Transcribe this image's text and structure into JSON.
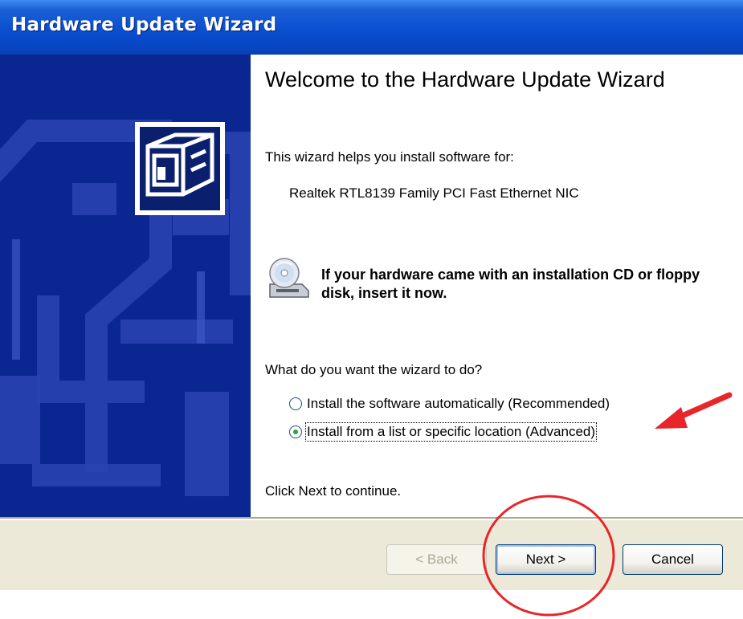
{
  "window": {
    "title": "Hardware Update Wizard"
  },
  "content": {
    "heading": "Welcome to the Hardware Update Wizard",
    "intro": "This wizard helps you install software for:",
    "device_name": "Realtek RTL8139 Family PCI Fast Ethernet NIC",
    "cd_prompt": "If your hardware came with an installation CD or floppy disk, insert it now.",
    "question": "What do you want the wizard to do?",
    "options": [
      {
        "label": "Install the software automatically (Recommended)",
        "selected": false
      },
      {
        "label": "Install from a list or specific location (Advanced)",
        "selected": true
      }
    ],
    "continue_hint": "Click Next to continue."
  },
  "buttons": {
    "back": "< Back",
    "next": "Next >",
    "cancel": "Cancel"
  },
  "icons": {
    "wizard": "hardware-card-icon",
    "cd": "cd-drive-icon"
  },
  "colors": {
    "titlebar": "#0a4fd0",
    "side_panel": "#0a2690",
    "footer": "#ece9d8",
    "annotation": "#e8262a"
  }
}
